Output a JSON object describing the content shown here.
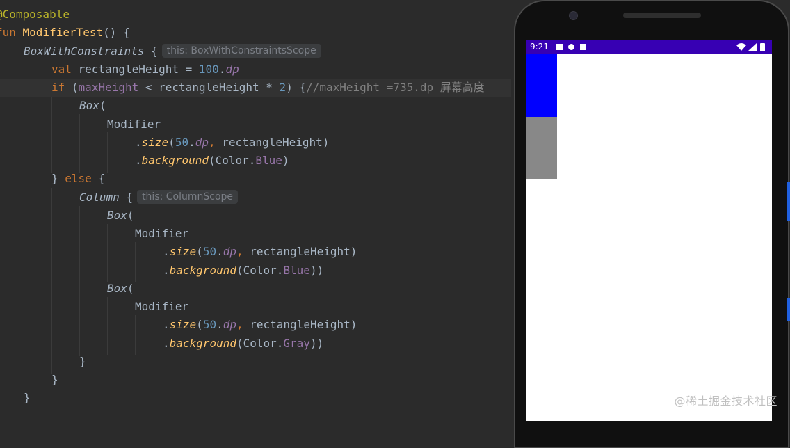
{
  "editor": {
    "lines": [
      [
        "@Composable"
      ],
      [
        "fun ",
        "ModifierTest",
        "() {"
      ],
      [
        "BoxWithConstraints",
        " {",
        "this: BoxWithConstraintsScope"
      ],
      [
        "val ",
        "rectangleHeight = ",
        "100",
        ".",
        "dp"
      ],
      [
        "if ",
        "(",
        "maxHeight",
        " < rectangleHeight * ",
        "2",
        ") {",
        "//maxHeight =735.dp 屏幕高度"
      ],
      [
        "Box",
        "("
      ],
      [
        "Modifier"
      ],
      [
        ".",
        "size",
        "(",
        "50",
        ".",
        "dp",
        ", ",
        "rectangleHeight)"
      ],
      [
        ".",
        "background",
        "(Color.",
        "Blue",
        ")"
      ],
      [
        "} ",
        "else",
        " {"
      ],
      [
        "Column",
        " {",
        "this: ColumnScope"
      ],
      [
        "Box",
        "("
      ],
      [
        "Modifier"
      ],
      [
        ".",
        "size",
        "(",
        "50",
        ".",
        "dp",
        ", ",
        "rectangleHeight)"
      ],
      [
        ".",
        "background",
        "(Color.",
        "Blue",
        "))"
      ],
      [
        "Box",
        "("
      ],
      [
        "Modifier"
      ],
      [
        ".",
        "size",
        "(",
        "50",
        ".",
        "dp",
        ", ",
        "rectangleHeight)"
      ],
      [
        ".",
        "background",
        "(Color.",
        "Gray",
        "))"
      ],
      [
        "}"
      ],
      [
        "}"
      ],
      [
        "}"
      ]
    ]
  },
  "phone": {
    "status_time": "9:21",
    "icons": [
      "notification-a-icon",
      "location-icon",
      "sd-card-icon",
      "wifi-icon",
      "signal-icon",
      "battery-icon"
    ],
    "boxes": [
      {
        "name": "blue-box",
        "color": "#0000ff"
      },
      {
        "name": "gray-box",
        "color": "#888888"
      }
    ]
  },
  "watermark": "@稀土掘金技术社区",
  "colors": {
    "editor_bg": "#2b2b2b",
    "keyword": "#cc7832",
    "function": "#ffc66d",
    "number": "#6897bb",
    "property": "#9876aa",
    "comment": "#808080",
    "status_bar": "#3700b3"
  }
}
